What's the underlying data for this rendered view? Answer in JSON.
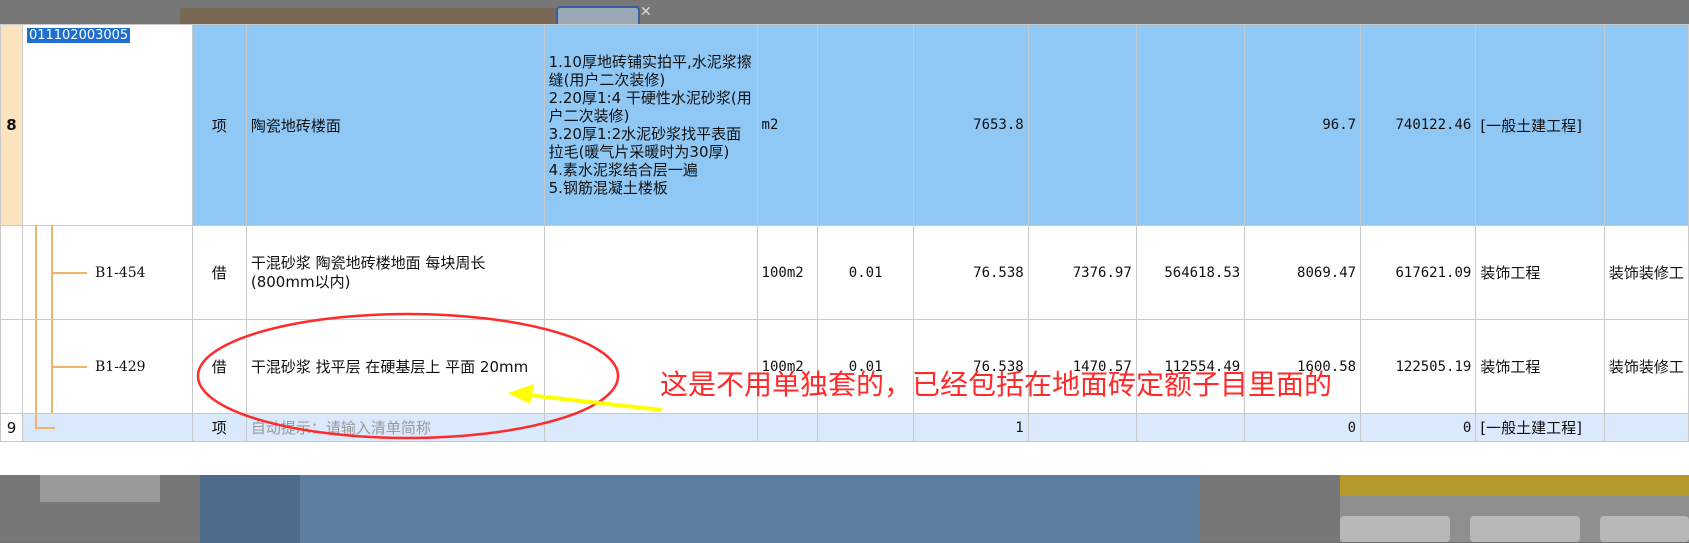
{
  "table": {
    "row8": {
      "row_no": "8",
      "code": "011102003005",
      "type": "项",
      "name": "陶瓷地砖楼面",
      "desc": [
        "1.10厚地砖铺实拍平,水泥浆擦缝(用户二次装修)",
        "2.20厚1:4 干硬性水泥砂浆(用户二次装修)",
        "3.20厚1:2水泥砂浆找平表面拉毛(暖气片采暖时为30厚)",
        "4.素水泥浆结合层一遍",
        "5.钢筋混凝土楼板"
      ],
      "unit": "m2",
      "coef": "",
      "qty": "7653.8",
      "c1": "",
      "c2": "",
      "price": "96.7",
      "total": "740122.46",
      "category": "[一般土建工程]",
      "extra": ""
    },
    "sub1": {
      "code": "B1-454",
      "type": "借",
      "name": "干混砂浆 陶瓷地砖楼地面 每块周长(800mm以内)",
      "desc": "",
      "unit": "100m2",
      "coef": "0.01",
      "qty": "76.538",
      "c1": "7376.97",
      "c2": "564618.53",
      "price": "8069.47",
      "total": "617621.09",
      "category": "装饰工程",
      "extra": "装饰装修工"
    },
    "sub2": {
      "code": "B1-429",
      "type": "借",
      "name": "干混砂浆 找平层 在硬基层上 平面 20mm",
      "desc": "",
      "unit": "100m2",
      "coef": "0.01",
      "qty": "76.538",
      "c1": "1470.57",
      "c2": "112554.49",
      "price": "1600.58",
      "total": "122505.19",
      "category": "装饰工程",
      "extra": "装饰装修工"
    },
    "row9": {
      "row_no": "9",
      "type": "项",
      "name_hint": "自动提示：请输入清单简称",
      "qty": "1",
      "price": "0",
      "total": "0",
      "category": "[一般土建工程]"
    }
  },
  "annotation": {
    "text": "这是不用单独套的，已经包括在地面砖定额子目里面的",
    "color": "#ff2a2a",
    "arrow_color": "#ffff00"
  }
}
